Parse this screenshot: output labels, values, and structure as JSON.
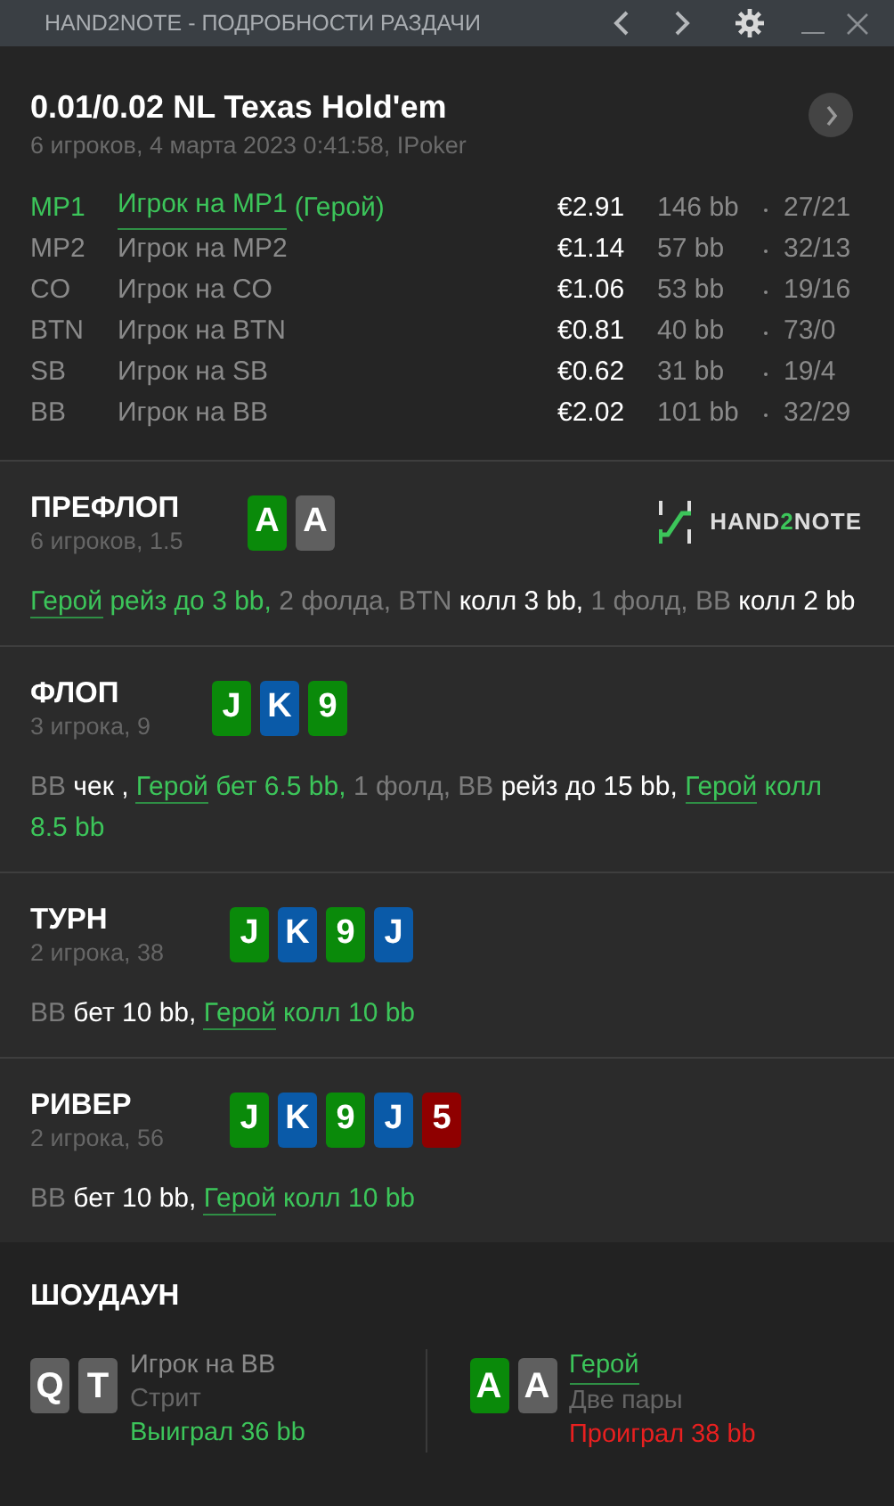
{
  "window": {
    "title": "HAND2NOTE - ПОДРОБНОСТИ РАЗДАЧИ"
  },
  "hand": {
    "title": "0.01/0.02 NL Texas Hold'em",
    "subtitle": "6 игроков, 4 марта 2023 0:41:58, IPoker"
  },
  "players": [
    {
      "position": "MP1",
      "name": "Игрок на MP1",
      "hero": true,
      "hero_tag": "(Герой)",
      "stack": "€2.91",
      "bb": "146 bb",
      "stats": "27/21"
    },
    {
      "position": "MP2",
      "name": "Игрок на MP2",
      "hero": false,
      "stack": "€1.14",
      "bb": "57 bb",
      "stats": "32/13"
    },
    {
      "position": "CO",
      "name": "Игрок на CO",
      "hero": false,
      "stack": "€1.06",
      "bb": "53 bb",
      "stats": "19/16"
    },
    {
      "position": "BTN",
      "name": "Игрок на BTN",
      "hero": false,
      "stack": "€0.81",
      "bb": "40 bb",
      "stats": "73/0"
    },
    {
      "position": "SB",
      "name": "Игрок на SB",
      "hero": false,
      "stack": "€0.62",
      "bb": "31 bb",
      "stats": "19/4"
    },
    {
      "position": "BB",
      "name": "Игрок на BB",
      "hero": false,
      "stack": "€2.02",
      "bb": "101 bb",
      "stats": "32/29"
    }
  ],
  "streets": [
    {
      "name": "ПРЕФЛОП",
      "info": "6 игроков, 1.5",
      "logo": [
        "HAND",
        "2",
        "NOTE"
      ],
      "cards": [
        {
          "rank": "A",
          "color": "#0a8a0a"
        },
        {
          "rank": "A",
          "color": "#5f5f5f"
        }
      ],
      "actions": [
        {
          "kind": "hero",
          "text": "Герой"
        },
        {
          "kind": "hero_action",
          "text": " рейз до 3 bb,"
        },
        {
          "kind": "plain",
          "text": " 2 фолда, BTN"
        },
        {
          "kind": "action",
          "text": " колл 3 bb,"
        },
        {
          "kind": "plain",
          "text": " 1 фолд, BB"
        },
        {
          "kind": "action",
          "text": " колл 2 bb"
        }
      ]
    },
    {
      "name": "ФЛОП",
      "info": "3 игрока, 9",
      "cards": [
        {
          "rank": "J",
          "color": "#0a8a0a"
        },
        {
          "rank": "K",
          "color": "#0a5aa8"
        },
        {
          "rank": "9",
          "color": "#0a8a0a"
        }
      ],
      "actions": [
        {
          "kind": "plain",
          "text": "BB"
        },
        {
          "kind": "action",
          "text": " чек , "
        },
        {
          "kind": "hero",
          "text": "Герой"
        },
        {
          "kind": "hero_action",
          "text": " бет 6.5 bb,"
        },
        {
          "kind": "plain",
          "text": " 1 фолд, BB"
        },
        {
          "kind": "action",
          "text": " рейз до 15 bb, "
        },
        {
          "kind": "hero",
          "text": "Герой"
        },
        {
          "kind": "hero_action",
          "text": " колл 8.5 bb"
        }
      ]
    },
    {
      "name": "ТУРН",
      "info": "2 игрока, 38",
      "cards": [
        {
          "rank": "J",
          "color": "#0a8a0a"
        },
        {
          "rank": "K",
          "color": "#0a5aa8"
        },
        {
          "rank": "9",
          "color": "#0a8a0a"
        },
        {
          "rank": "J",
          "color": "#0a5aa8"
        }
      ],
      "actions": [
        {
          "kind": "plain",
          "text": "BB"
        },
        {
          "kind": "action",
          "text": " бет 10 bb, "
        },
        {
          "kind": "hero",
          "text": "Герой"
        },
        {
          "kind": "hero_action",
          "text": " колл 10 bb"
        }
      ]
    },
    {
      "name": "РИВЕР",
      "info": "2 игрока, 56",
      "cards": [
        {
          "rank": "J",
          "color": "#0a8a0a"
        },
        {
          "rank": "K",
          "color": "#0a5aa8"
        },
        {
          "rank": "9",
          "color": "#0a8a0a"
        },
        {
          "rank": "J",
          "color": "#0a5aa8"
        },
        {
          "rank": "5",
          "color": "#8f0000"
        }
      ],
      "actions": [
        {
          "kind": "plain",
          "text": "BB"
        },
        {
          "kind": "action",
          "text": " бет 10 bb, "
        },
        {
          "kind": "hero",
          "text": "Герой"
        },
        {
          "kind": "hero_action",
          "text": " колл 10 bb"
        }
      ]
    }
  ],
  "showdown": {
    "title": "ШОУДАУН",
    "players": [
      {
        "cards": [
          {
            "rank": "Q",
            "color": "#5f5f5f"
          },
          {
            "rank": "T",
            "color": "#5f5f5f"
          }
        ],
        "name": "Игрок на BB",
        "hero": false,
        "hand": "Стрит",
        "result": "Выиграл 36 bb",
        "won": true
      },
      {
        "cards": [
          {
            "rank": "A",
            "color": "#0a8a0a"
          },
          {
            "rank": "A",
            "color": "#5f5f5f"
          }
        ],
        "name": "Герой",
        "hero": true,
        "hand": "Две пары",
        "result": "Проиграл 38 bb",
        "won": false
      }
    ]
  }
}
